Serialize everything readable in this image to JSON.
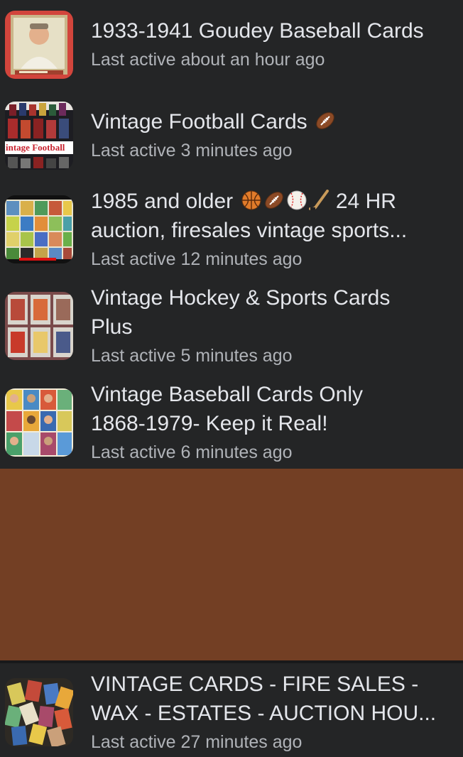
{
  "groups": [
    {
      "title": "1933-1941 Goudey Baseball Cards",
      "title_line2": "",
      "activity": "Last active about an hour ago",
      "thumb_icon": "goudey-card-thumbnail"
    },
    {
      "title": "Vintage Football Cards",
      "title_line2": "",
      "activity": "Last active 3 minutes ago",
      "thumb_icon": "football-cards-thumbnail",
      "thumb_text": "intage Football"
    },
    {
      "title": "1985 and older",
      "title_suffix": "24 HR",
      "title_line2": "auction, firesales vintage sports...",
      "activity": "Last active 12 minutes ago",
      "thumb_icon": "card-grid-thumbnail"
    },
    {
      "title": "Vintage Hockey & Sports Cards",
      "title_line2": "Plus",
      "activity": "Last active 5 minutes ago",
      "thumb_icon": "hockey-cards-thumbnail"
    },
    {
      "title": "Vintage Baseball Cards Only",
      "title_line2": "1868-1979- Keep it Real!",
      "activity": "Last active 6 minutes ago",
      "thumb_icon": "baseball-card-grid-thumbnail"
    },
    {
      "title": "VINTAGE CARDS - FIRE SALES -",
      "title_line2": "WAX - ESTATES - AUCTION HOU...",
      "activity": "Last active 27 minutes ago",
      "thumb_icon": "card-pile-thumbnail"
    }
  ],
  "colors": {
    "background": "#242526",
    "title": "#e4e6eb",
    "subtitle": "#b0b3b8",
    "ad_block": "#733f24"
  }
}
